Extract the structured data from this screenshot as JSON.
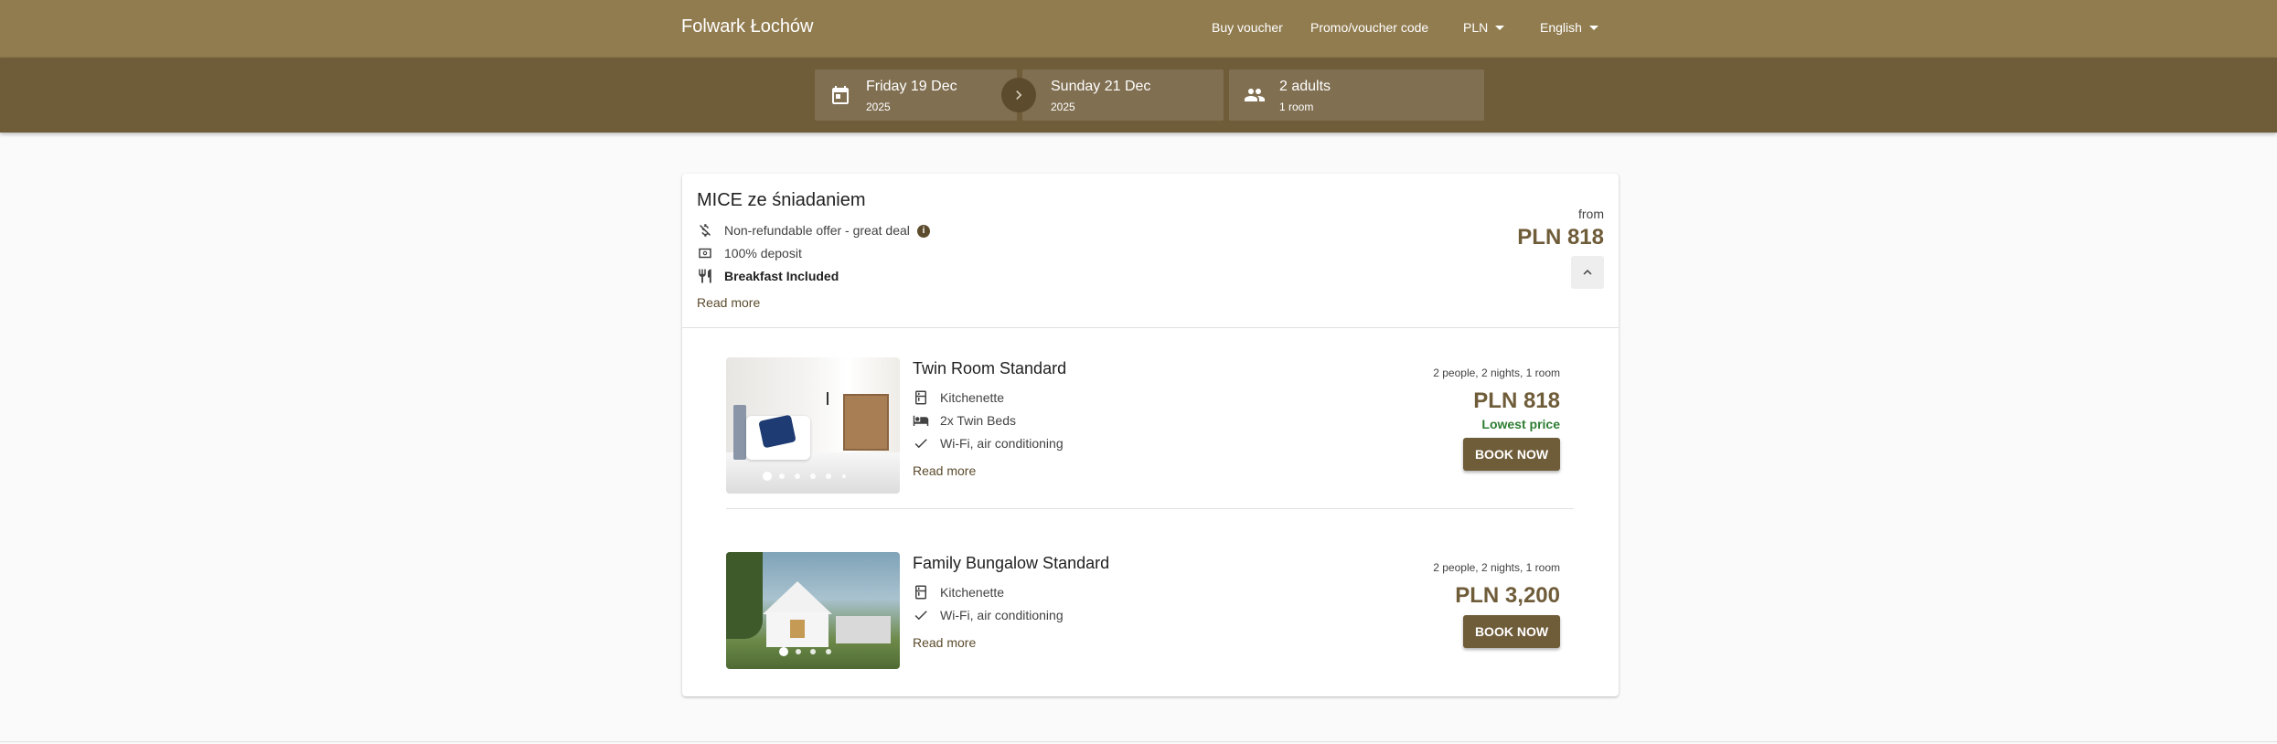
{
  "header": {
    "brand": "Folwark Łochów",
    "buy_voucher": "Buy voucher",
    "promo_code": "Promo/voucher code",
    "currency": "PLN",
    "language": "English"
  },
  "search": {
    "checkin_day": "Friday 19 Dec",
    "checkin_year": "2025",
    "checkout_day": "Sunday 21 Dec",
    "checkout_year": "2025",
    "guests": "2 adults",
    "rooms": "1 room",
    "icons": {
      "checkin": "calendar-icon",
      "arrow": "chevron-right-icon",
      "guests": "people-icon"
    }
  },
  "offer": {
    "title": "MICE ze śniadaniem",
    "features": [
      {
        "icon": "no-money-back-icon",
        "text": "Non-refundable offer - great deal"
      },
      {
        "icon": "cash-deposit-icon",
        "text": "100% deposit"
      },
      {
        "icon": "fork-knife-icon",
        "text": "Breakfast Included"
      }
    ],
    "info_icon": "info-icon",
    "read_more": "Read more",
    "from_label": "from",
    "price": "PLN 818",
    "collapse_icon": "chevron-up-icon"
  },
  "rooms": [
    {
      "name": "Twin Room Standard",
      "features": [
        {
          "icon": "kitchen-icon",
          "text": "Kitchenette"
        },
        {
          "icon": "bed-icon",
          "text": "2x Twin Beds"
        },
        {
          "icon": "check-icon",
          "text": "Wi-Fi, air conditioning"
        }
      ],
      "read_more": "Read more",
      "meta": "2 people, 2 nights, 1 room",
      "price": "PLN 818",
      "badge": "Lowest price",
      "book": "BOOK NOW",
      "photo_count": 6,
      "photo_active": 1
    },
    {
      "name": "Family Bungalow Standard",
      "features": [
        {
          "icon": "kitchen-icon",
          "text": "Kitchenette"
        },
        {
          "icon": "check-icon",
          "text": "Wi-Fi, air conditioning"
        }
      ],
      "read_more": "Read more",
      "meta": "2 people, 2 nights, 1 room",
      "price": "PLN 3,200",
      "book": "BOOK NOW",
      "photo_count": 4,
      "photo_active": 1
    }
  ],
  "colors": {
    "topbar": "#917c4f",
    "searchbar": "#6f5c39",
    "accent": "#6f5c39",
    "badge_green": "#2e7d32"
  }
}
